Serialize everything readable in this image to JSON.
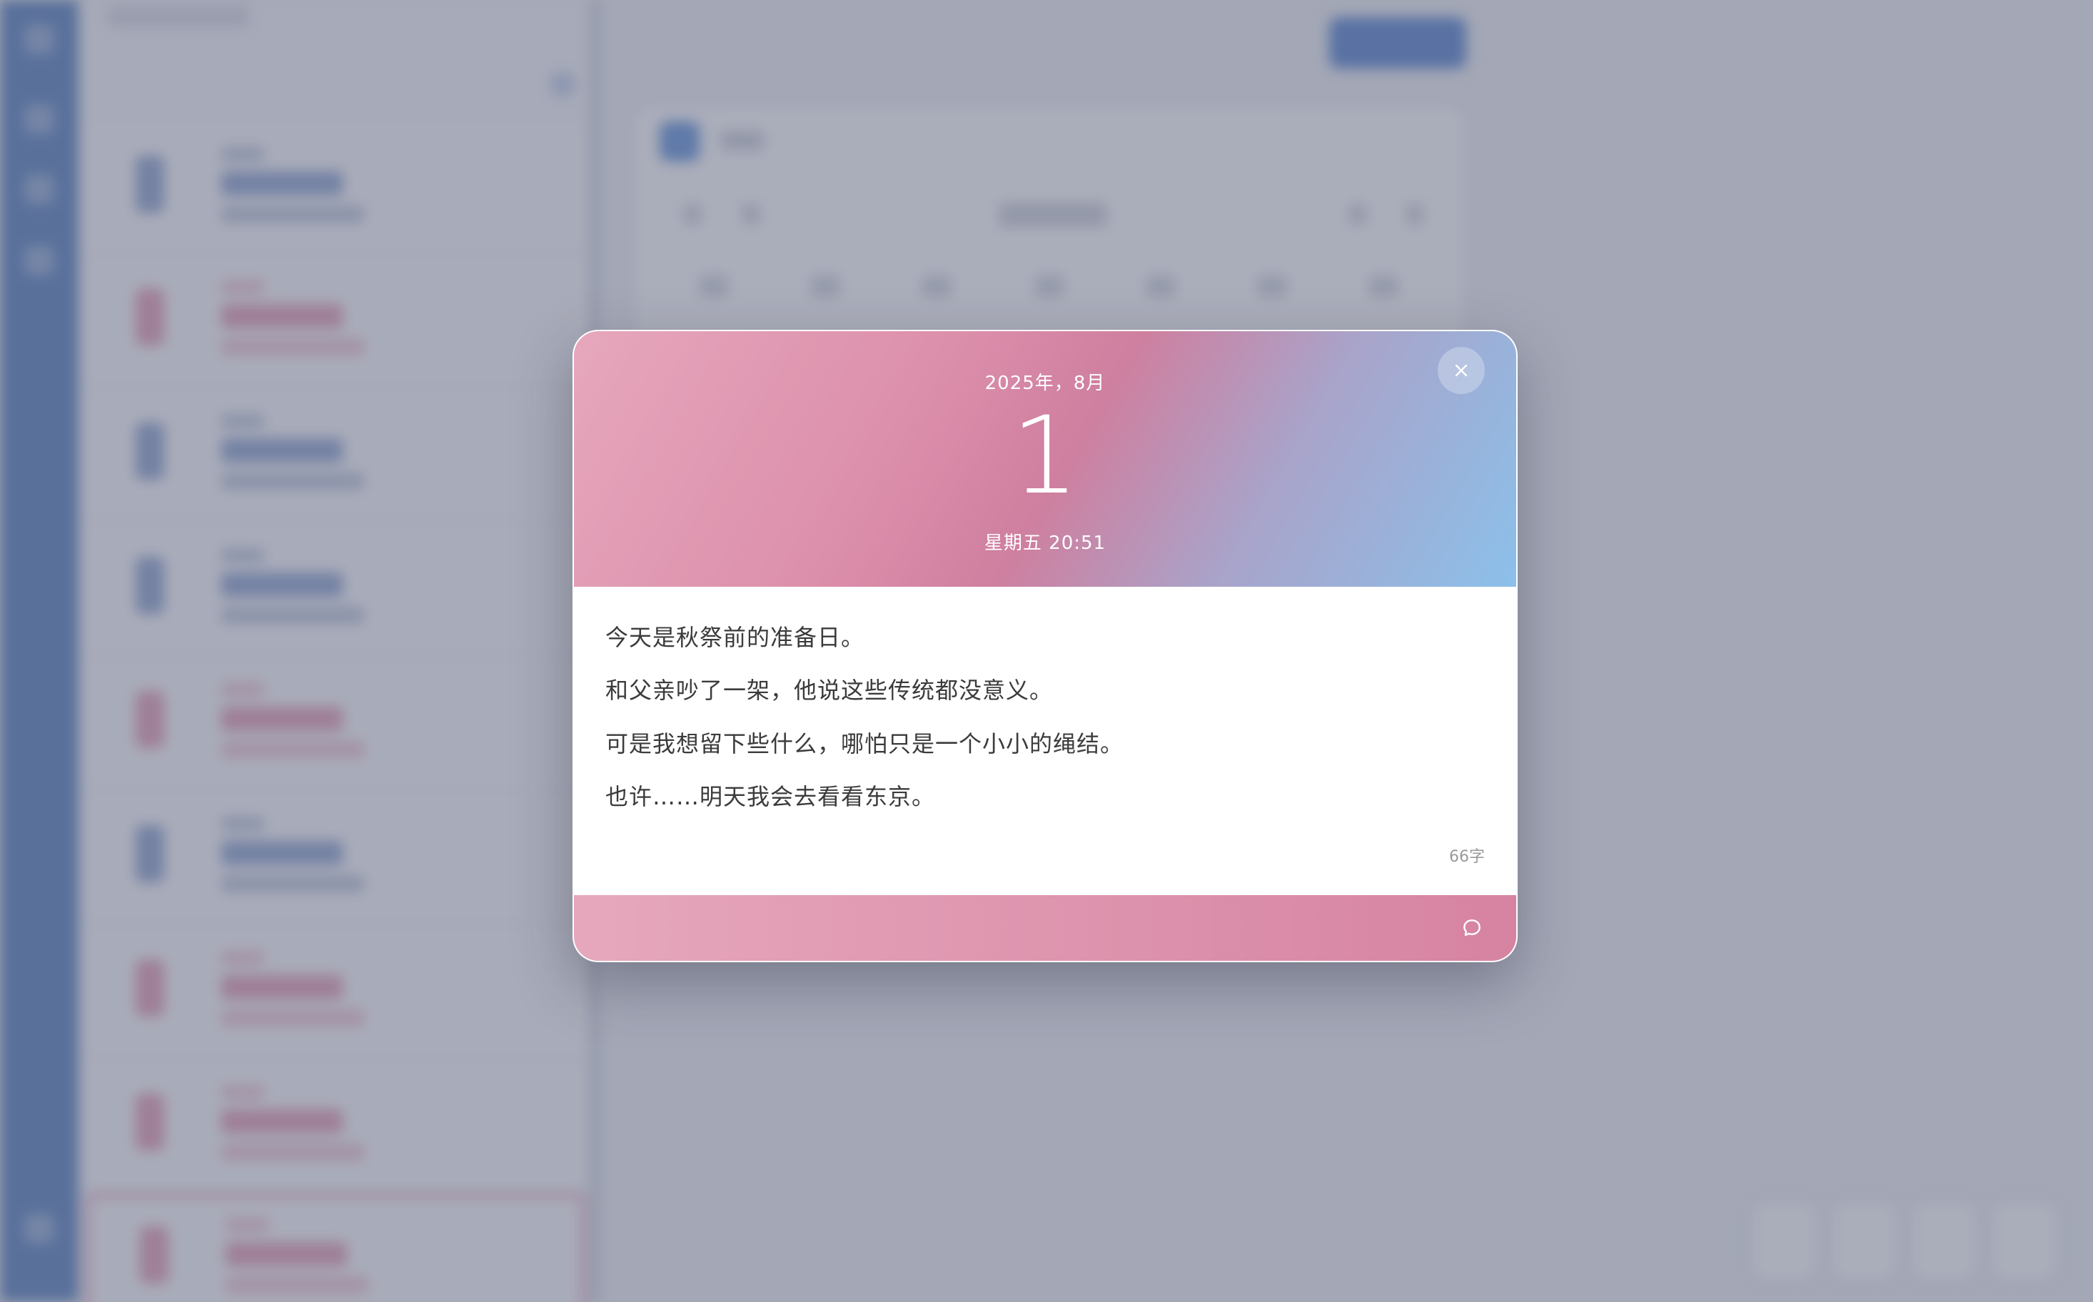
{
  "diary": {
    "year_month": "2025年，8月",
    "day": "1",
    "weekday_time": "星期五 20:51",
    "lines": [
      "今天是秋祭前的准备日。",
      "和父亲吵了一架，他说这些传统都没意义。",
      "可是我想留下些什么，哪怕只是一个小小的绳结。",
      "也许……明天我会去看看东京。"
    ],
    "word_count": "66字"
  },
  "icons": {
    "close": "close-icon",
    "comment": "comment-icon"
  },
  "colors": {
    "header_gradient": [
      "#e6a7bc",
      "#cf7f9f",
      "#8bc0ea"
    ],
    "footer_gradient": [
      "#e6a7bc",
      "#d683a1"
    ],
    "overlay": "#6c7288",
    "rail": "#3f6fb5"
  }
}
